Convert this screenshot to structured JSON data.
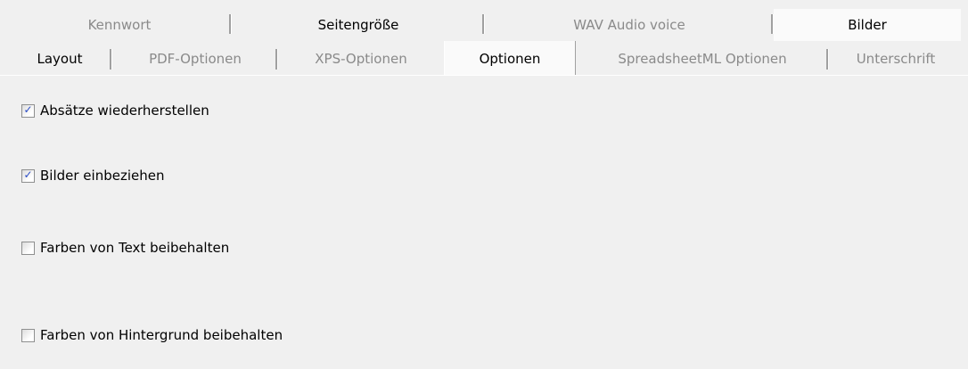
{
  "tabs_row1": [
    {
      "label": "Kennwort",
      "selected": false
    },
    {
      "label": "Seitengröße",
      "selected": true
    },
    {
      "label": "WAV Audio voice",
      "selected": false
    },
    {
      "label": "Bilder",
      "selected": true
    }
  ],
  "tabs_row2": [
    {
      "label": "Layout",
      "selected": true
    },
    {
      "label": "PDF-Optionen",
      "selected": false
    },
    {
      "label": "XPS-Optionen",
      "selected": false
    },
    {
      "label": "Optionen",
      "selected": true,
      "active": true
    },
    {
      "label": "SpreadsheetML Optionen",
      "selected": false
    },
    {
      "label": "Unterschrift",
      "selected": false
    }
  ],
  "options": [
    {
      "label": "Absätze wiederherstellen",
      "checked": true
    },
    {
      "label": "Bilder einbeziehen",
      "checked": true
    },
    {
      "label": "Farben von Text beibehalten",
      "checked": false
    },
    {
      "label": "Farben von Hintergrund beibehalten",
      "checked": false
    }
  ],
  "colors": {
    "background": "#f0f0f0",
    "inactive_tab_text": "#8a8a8a",
    "check_mark": "#2a4bc4"
  },
  "icons": {
    "check": "check-mark-icon"
  }
}
